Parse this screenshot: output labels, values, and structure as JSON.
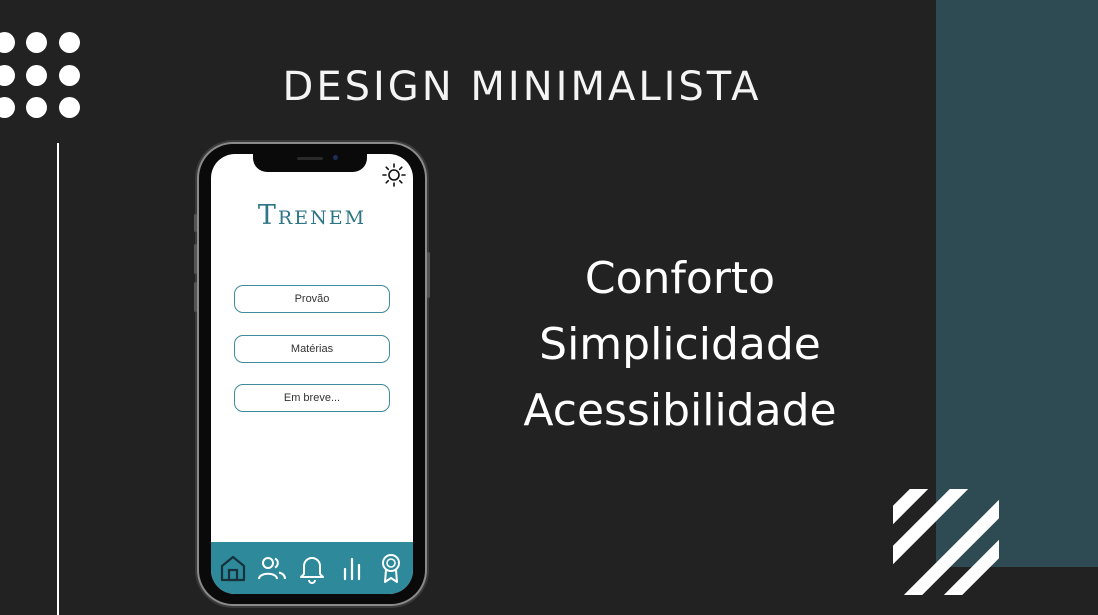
{
  "slide": {
    "title": "DESIGN MINIMALISTA",
    "features": [
      "Conforto",
      "Simplicidade",
      "Acessibilidade"
    ]
  },
  "app": {
    "logo": "Trenem",
    "theme_toggle_icon": "sun-icon",
    "menu": [
      {
        "label": "Provão"
      },
      {
        "label": "Matérias"
      },
      {
        "label": "Em breve..."
      }
    ],
    "tabbar": [
      {
        "icon": "home-icon",
        "active": true
      },
      {
        "icon": "users-icon",
        "active": false
      },
      {
        "icon": "bell-icon",
        "active": false
      },
      {
        "icon": "bar-chart-icon",
        "active": false
      },
      {
        "icon": "award-icon",
        "active": false
      }
    ]
  },
  "colors": {
    "background": "#222222",
    "accent_band": "#2e4a52",
    "app_accent": "#2e8a9b",
    "logo": "#2d7686",
    "text": "#ffffff"
  }
}
